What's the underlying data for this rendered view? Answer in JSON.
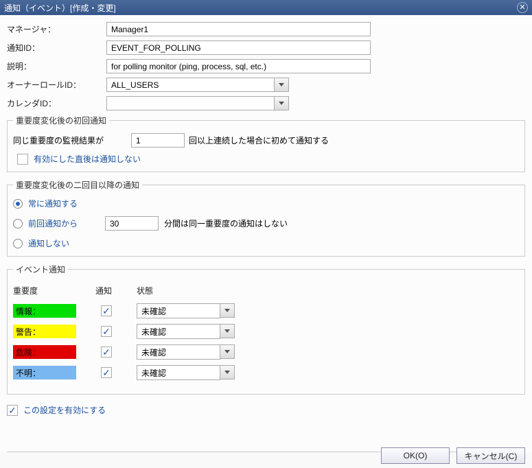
{
  "titlebar": {
    "title": "通知（イベント）[作成・変更]"
  },
  "fields": {
    "manager_label": "マネージャ：",
    "manager_value": "Manager1",
    "notify_id_label": "通知ID：",
    "notify_id_value": "EVENT_FOR_POLLING",
    "desc_label": "説明：",
    "desc_value": "for polling monitor (ping, process, sql, etc.)",
    "owner_label": "オーナーロールID：",
    "owner_value": "ALL_USERS",
    "calendar_label": "カレンダID：",
    "calendar_value": ""
  },
  "group1": {
    "legend": "重要度変化後の初回通知",
    "text_before": "同じ重要度の監視結果が",
    "count": "1",
    "text_after": "回以上連続した場合に初めて通知する",
    "checkbox_label": "有効にした直後は通知しない",
    "checkbox_checked": false
  },
  "group2": {
    "legend": "重要度変化後の二回目以降の通知",
    "opt_always": "常に通知する",
    "opt_since": "前回通知から",
    "since_value": "30",
    "since_after": "分間は同一重要度の通知はしない",
    "opt_none": "通知しない",
    "selected": "always"
  },
  "group3": {
    "legend": "イベント通知",
    "header_sev": "重要度",
    "header_notify": "通知",
    "header_status": "状態",
    "rows": [
      {
        "label": "情報：",
        "class": "sev-info",
        "checked": true,
        "status": "未確認"
      },
      {
        "label": "警告：",
        "class": "sev-warn",
        "checked": true,
        "status": "未確認"
      },
      {
        "label": "危険：",
        "class": "sev-crit",
        "checked": true,
        "status": "未確認"
      },
      {
        "label": "不明：",
        "class": "sev-unk",
        "checked": true,
        "status": "未確認"
      }
    ]
  },
  "enable": {
    "label": "この設定を有効にする",
    "checked": true
  },
  "buttons": {
    "ok": "OK(O)",
    "cancel": "キャンセル(C)"
  }
}
